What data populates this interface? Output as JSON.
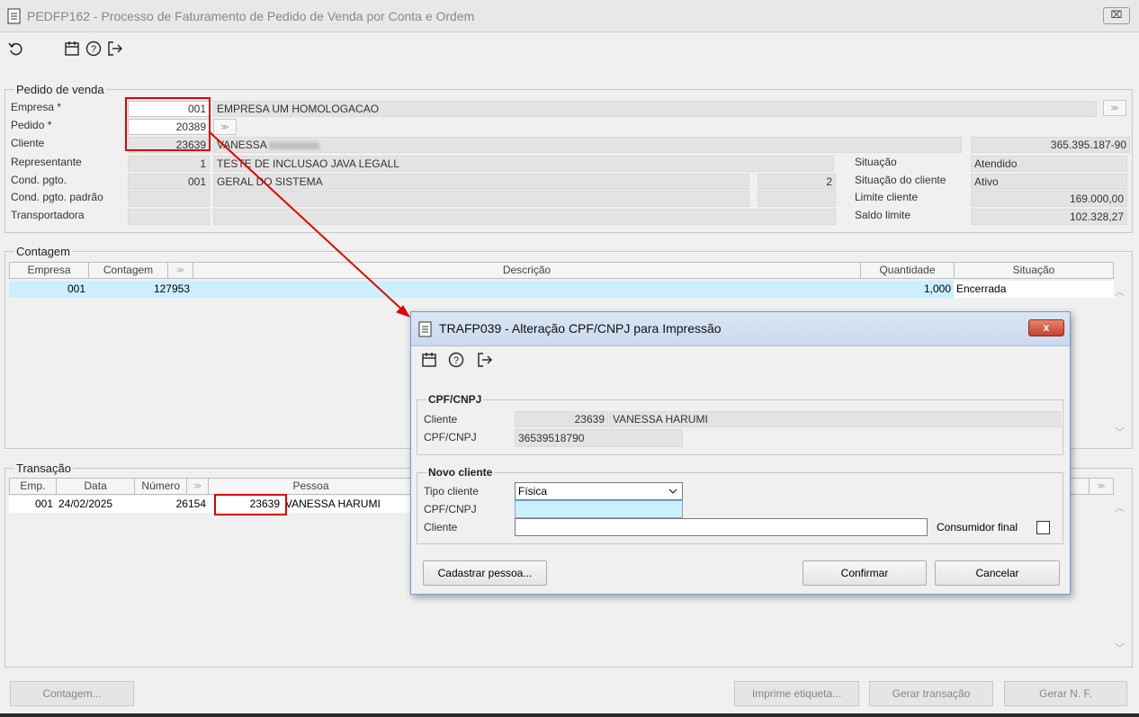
{
  "window": {
    "title": "PEDFP162 - Processo de Faturamento de Pedido de Venda por Conta e Ordem",
    "close_label": "⌧"
  },
  "pedido": {
    "legend": "Pedido de venda",
    "labels": {
      "empresa": "Empresa *",
      "pedido": "Pedido *",
      "cliente": "Cliente",
      "representante": "Representante",
      "cond_pgto": "Cond. pgto.",
      "cond_pgto_padrao": "Cond. pgto. padrão",
      "transportadora": "Transportadora",
      "situacao": "Situação",
      "situacao_cliente": "Situação do cliente",
      "limite_cliente": "Limite cliente",
      "saldo_limite": "Saldo limite"
    },
    "empresa_code": "001",
    "empresa_name": "EMPRESA UM HOMOLOGACAO",
    "pedido_number": "20389",
    "cliente_code": "23639",
    "cliente_name": "VANESSA",
    "cliente_doc": "365.395.187-90",
    "representante_code": "1",
    "representante_name": "TESTE DE INCLUSAO JAVA LEGALL",
    "cond_pgto_code": "001",
    "cond_pgto_name": "GERAL DO SISTEMA",
    "cond_pgto_parcelas": "2",
    "situacao": "Atendido",
    "situacao_cliente": "Ativo",
    "limite_cliente": "169.000,00",
    "saldo_limite": "102.328,27"
  },
  "contagem": {
    "legend": "Contagem",
    "columns": [
      "Empresa",
      "Contagem",
      "Descrição",
      "Quantidade",
      "Situação"
    ],
    "rows": [
      {
        "empresa": "001",
        "contagem": "127953",
        "descricao": "",
        "quantidade": "1,000",
        "situacao": "Encerrada"
      }
    ]
  },
  "transacao": {
    "legend": "Transação",
    "columns": [
      "Emp.",
      "Data",
      "Número",
      "Pessoa"
    ],
    "rows": [
      {
        "emp": "001",
        "data": "24/02/2025",
        "numero": "26154",
        "pessoa_code": "23639",
        "pessoa_name": "VANESSA HARUMI"
      }
    ]
  },
  "bottom_buttons": {
    "contagem": "Contagem...",
    "imprime_etiqueta": "Imprime etiqueta...",
    "gerar_transacao": "Gerar transação",
    "gerar_nf": "Gerar N. F."
  },
  "dialog": {
    "title": "TRAFP039 - Alteração CPF/CNPJ para Impressão",
    "close_label": "x",
    "cpf_group": {
      "legend": "CPF/CNPJ",
      "cliente_label": "Cliente",
      "cliente_code": "23639",
      "cliente_name": "VANESSA HARUMI",
      "cpf_label": "CPF/CNPJ",
      "cpf_value": "36539518790"
    },
    "novo_cliente": {
      "legend": "Novo cliente",
      "tipo_label": "Tipo cliente",
      "tipo_value": "Física",
      "cpf_label": "CPF/CNPJ",
      "cpf_value": "",
      "cliente_label": "Cliente",
      "cliente_value": "",
      "consumidor_label": "Consumidor final"
    },
    "buttons": {
      "cadastrar": "Cadastrar pessoa...",
      "confirmar": "Confirmar",
      "cancelar": "Cancelar"
    }
  },
  "colors": {
    "highlight_row": "#cceffd",
    "annotation_red": "#e00000",
    "dialog_border": "#6f9ad6"
  },
  "icons": [
    "document-icon",
    "undo-icon",
    "calendar-icon",
    "help-icon",
    "exit-icon",
    "lookup-icon",
    "chevron-down-icon",
    "scroll-up-icon",
    "scroll-down-icon"
  ]
}
